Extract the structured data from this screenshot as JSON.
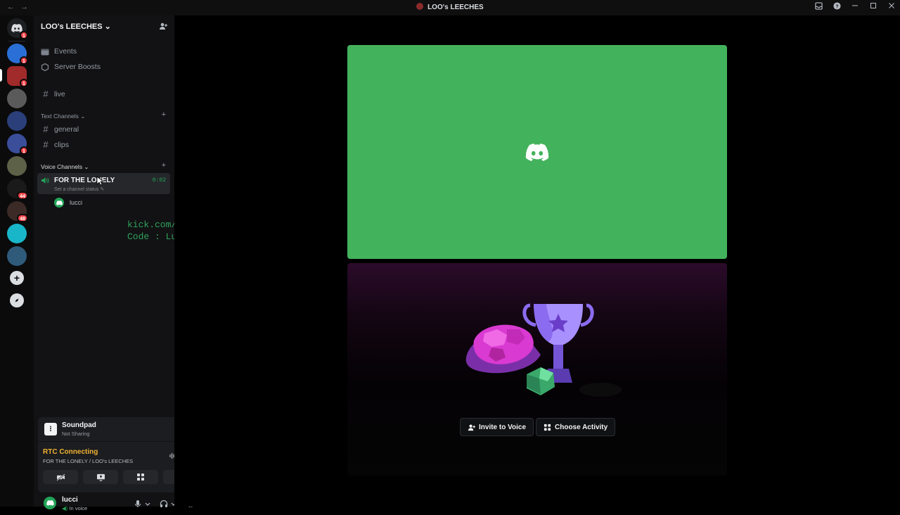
{
  "window": {
    "title": "LOO's LEECHES",
    "nav_back": "←",
    "nav_forward": "→",
    "tools": [
      "inbox-icon",
      "help-icon",
      "minimize-icon",
      "maximize-icon",
      "close-icon"
    ]
  },
  "servers": {
    "badges": [
      "1",
      "1",
      "1",
      "1",
      "44",
      "48"
    ]
  },
  "guild": {
    "name": "LOO's LEECHES ⌄"
  },
  "channels": {
    "top_items": [
      {
        "label": "Events",
        "icon": "calendar-icon"
      },
      {
        "label": "Server Boosts",
        "icon": "boost-icon"
      }
    ],
    "standalone": [
      {
        "label": "live"
      }
    ],
    "text_category": "Text Channels ⌄",
    "text_channels": [
      {
        "label": "general"
      },
      {
        "label": "clips"
      }
    ],
    "voice_category": "Voice Channels ⌄",
    "voice_channel": {
      "name": "FOR THE LONELY",
      "status": "Set a channel status",
      "timer": "0:02"
    },
    "voice_users": [
      {
        "name": "lucci"
      }
    ]
  },
  "overlay": {
    "line1": "kick.com/YungLucci",
    "line2": "Code : Lucci"
  },
  "soundpad": {
    "title": "Soundpad",
    "status": "Not Sharing"
  },
  "rtc": {
    "status": "RTC Connecting",
    "location": "FOR THE LONELY / LOO's LEECHES"
  },
  "user": {
    "name": "lucci",
    "status": "In voice"
  },
  "stage": {
    "invite_label": "Invite to Voice",
    "activity_label": "Choose Activity"
  },
  "colors": {
    "tile_green": "#43b25c",
    "rtc_yellow": "#f0b232",
    "online_green": "#23a559",
    "badge_red": "#f23f43"
  }
}
